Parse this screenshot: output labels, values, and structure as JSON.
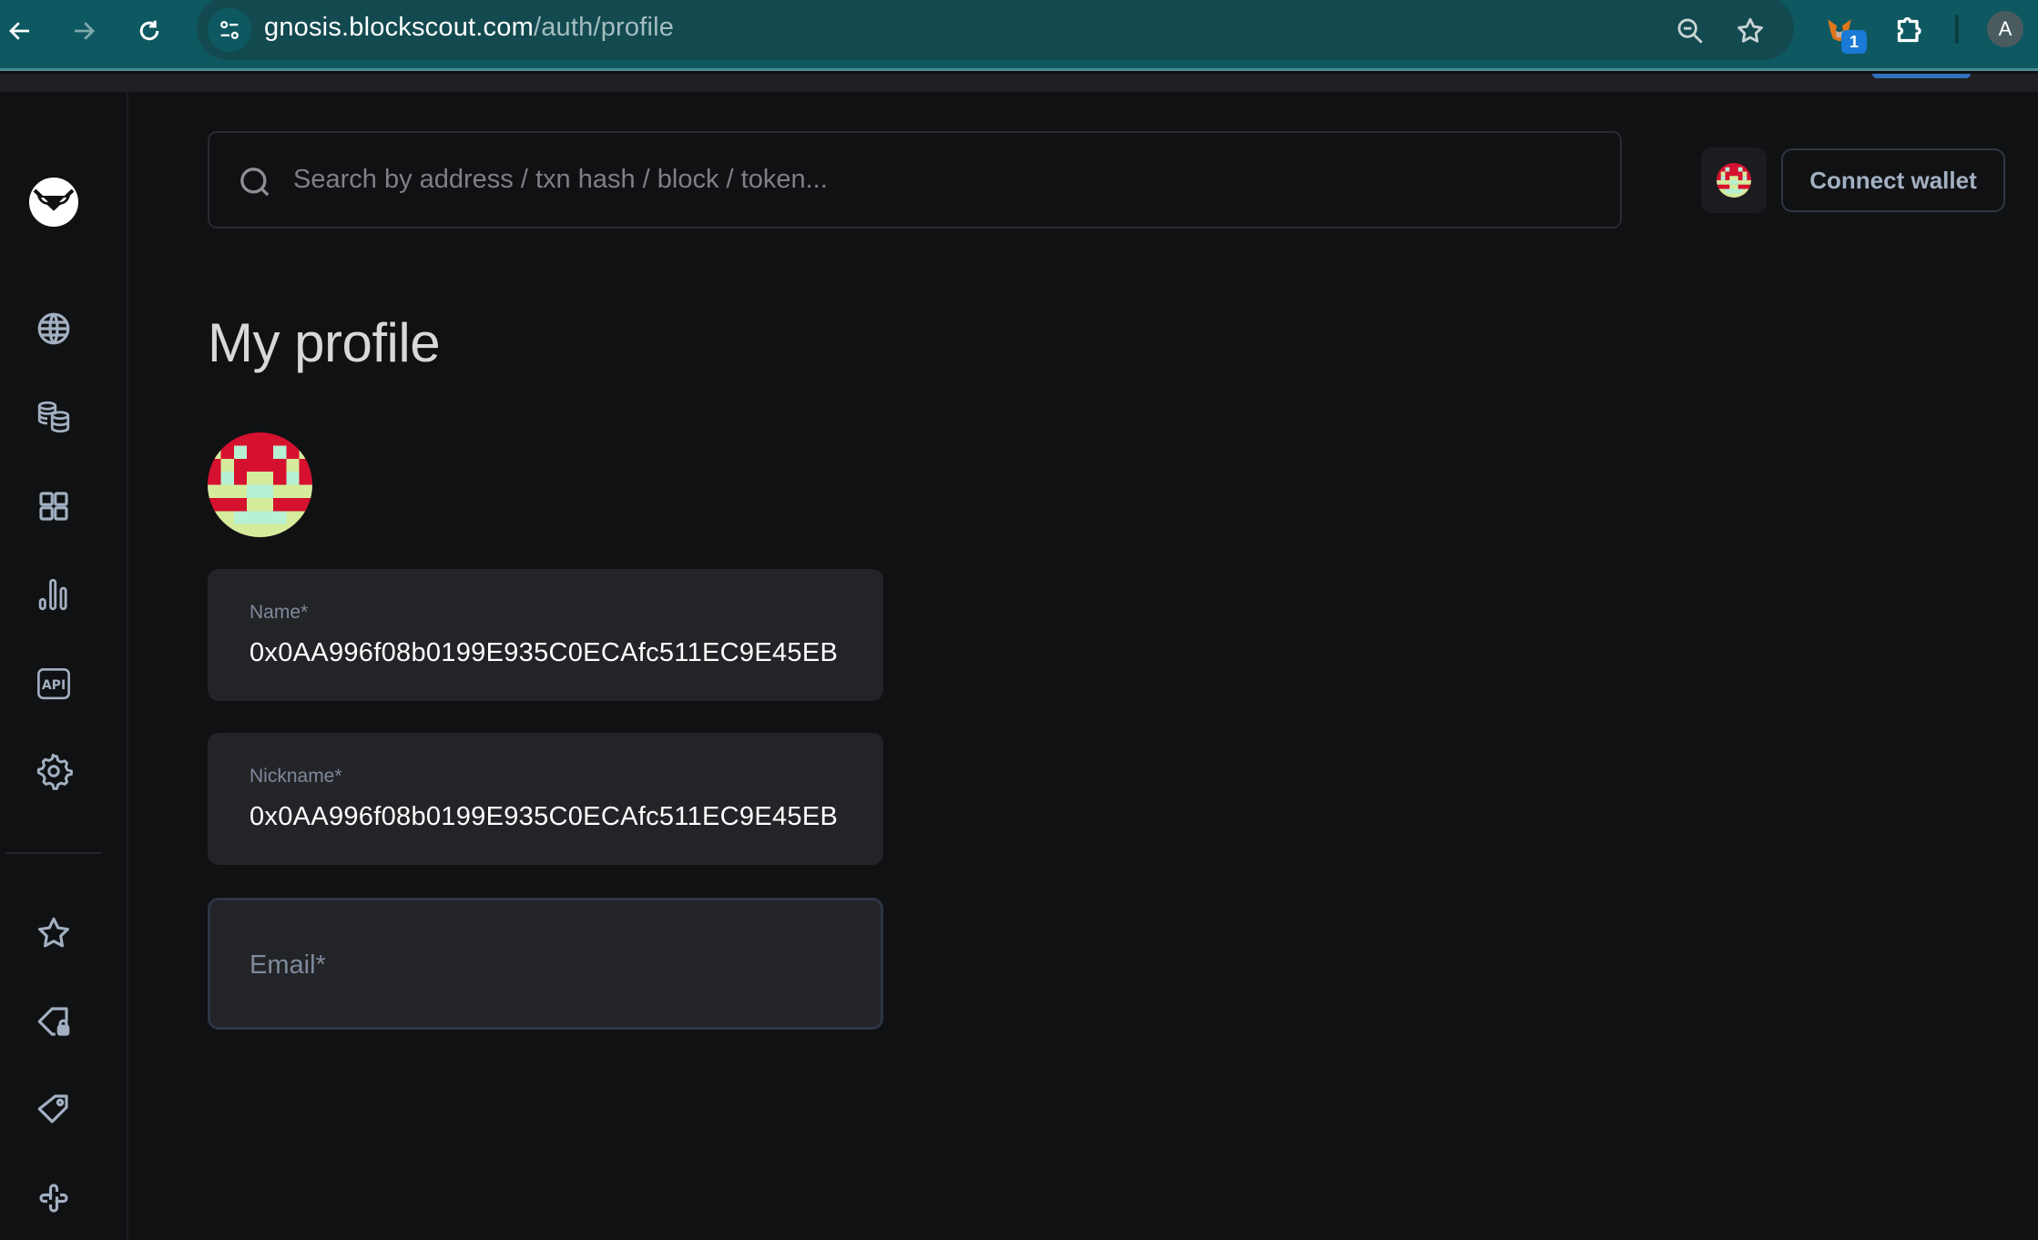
{
  "browser": {
    "url_host": "gnosis.blockscout.com",
    "url_path": "/auth/profile",
    "extension_badge": "1",
    "profile_initial": "A",
    "icons": [
      "back-arrow-icon",
      "forward-arrow-icon",
      "reload-icon",
      "site-info-icon",
      "zoom-out-icon",
      "bookmark-star-icon",
      "metamask-fox-icon",
      "extensions-puzzle-icon"
    ]
  },
  "sidebar": {
    "logo": "gnosis-owl-logo",
    "items": [
      {
        "name": "blockchain",
        "icon": "globe-icon"
      },
      {
        "name": "tokens",
        "icon": "coins-icon"
      },
      {
        "name": "apps",
        "icon": "grid-icon"
      },
      {
        "name": "charts-stats",
        "icon": "bar-chart-icon"
      },
      {
        "name": "api",
        "icon": "api-icon",
        "label": "API"
      },
      {
        "name": "other",
        "icon": "gear-icon"
      }
    ],
    "account_items": [
      {
        "name": "watchlist",
        "icon": "star-icon"
      },
      {
        "name": "private-tags",
        "icon": "tag-lock-icon"
      },
      {
        "name": "public-tags",
        "icon": "tag-icon"
      },
      {
        "name": "custom-abi",
        "icon": "cross-link-icon"
      }
    ]
  },
  "header": {
    "search_placeholder": "Search by address / txn hash / block / token...",
    "connect_wallet_label": "Connect wallet"
  },
  "main": {
    "title": "My profile",
    "fields": [
      {
        "label": "Name*",
        "value": "0x0AA996f08b0199E935C0ECAfc511EC9E45EB"
      },
      {
        "label": "Nickname*",
        "value": "0x0AA996f08b0199E935C0ECAfc511EC9E45EB"
      },
      {
        "label": "Email*",
        "value": ""
      }
    ]
  },
  "colors": {
    "background": "#101113",
    "chrome": "#0e5961",
    "field_bg": "#232427",
    "icon": "#a2b0c2",
    "avatar_red": "#d6112f",
    "avatar_yellow": "#d4ec9c",
    "avatar_mint": "#b8f0d4"
  }
}
